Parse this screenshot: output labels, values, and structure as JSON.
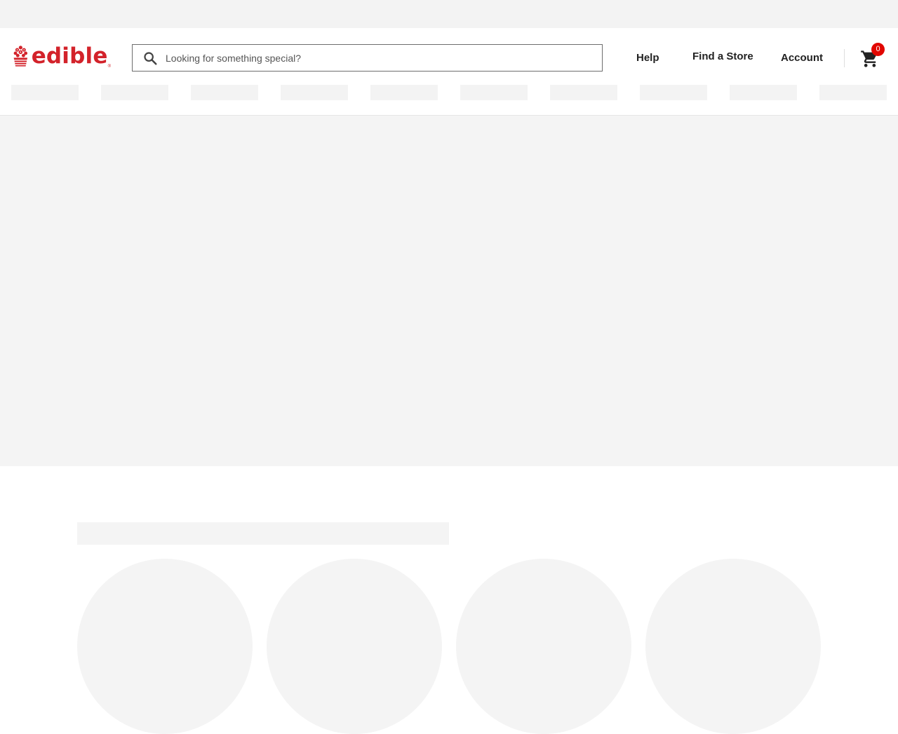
{
  "brand": {
    "name": "edible",
    "registered_mark": "®",
    "color": "#d3222a"
  },
  "search": {
    "placeholder": "Looking for something special?",
    "value": "",
    "icon": "search-icon"
  },
  "nav": {
    "help": "Help",
    "find_store": "Find a Store",
    "account": "Account"
  },
  "cart": {
    "icon": "cart-icon",
    "count": "0",
    "badge_color": "#e10600"
  },
  "menu": {
    "loading_placeholders": 10
  },
  "categories": {
    "loading_placeholders": 4
  }
}
